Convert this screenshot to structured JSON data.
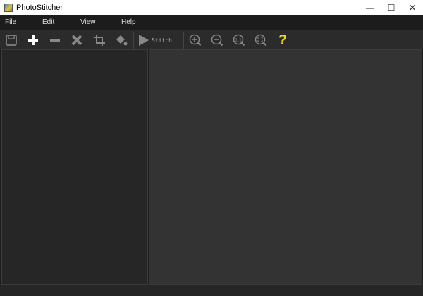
{
  "window": {
    "title": "PhotoStitcher",
    "minimize": "—",
    "maximize": "☐",
    "close": "✕"
  },
  "menu": [
    "File",
    "Edit",
    "View",
    "Help"
  ],
  "toolbar": {
    "stitch_label": "Stitch",
    "help_label": "?"
  },
  "colors": {
    "help": "#f0e000",
    "bg": "#333333"
  }
}
